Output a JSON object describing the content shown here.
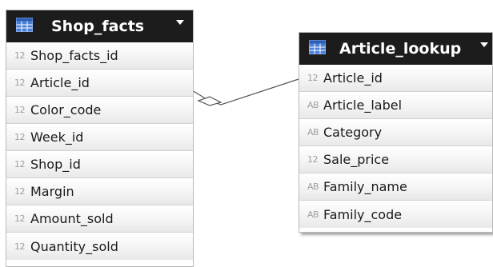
{
  "tables": {
    "shop_facts": {
      "title": "Shop_facts",
      "icon": "table-icon",
      "fields": [
        {
          "type": "12",
          "name": "Shop_facts_id"
        },
        {
          "type": "12",
          "name": "Article_id"
        },
        {
          "type": "12",
          "name": "Color_code"
        },
        {
          "type": "12",
          "name": "Week_id"
        },
        {
          "type": "12",
          "name": "Shop_id"
        },
        {
          "type": "12",
          "name": "Margin"
        },
        {
          "type": "12",
          "name": "Amount_sold"
        },
        {
          "type": "12",
          "name": "Quantity_sold"
        }
      ]
    },
    "article_lookup": {
      "title": "Article_lookup",
      "icon": "table-icon",
      "fields": [
        {
          "type": "12",
          "name": "Article_id"
        },
        {
          "type": "AB",
          "name": "Article_label"
        },
        {
          "type": "AB",
          "name": "Category"
        },
        {
          "type": "12",
          "name": "Sale_price"
        },
        {
          "type": "AB",
          "name": "Family_name"
        },
        {
          "type": "AB",
          "name": "Family_code"
        }
      ]
    }
  },
  "colors": {
    "header_bg": "#1c1c1c",
    "header_text": "#ffffff",
    "table_icon": "#4a7fd8",
    "type_glyph": "#a0a0a0",
    "relationship_line": "#555555"
  }
}
